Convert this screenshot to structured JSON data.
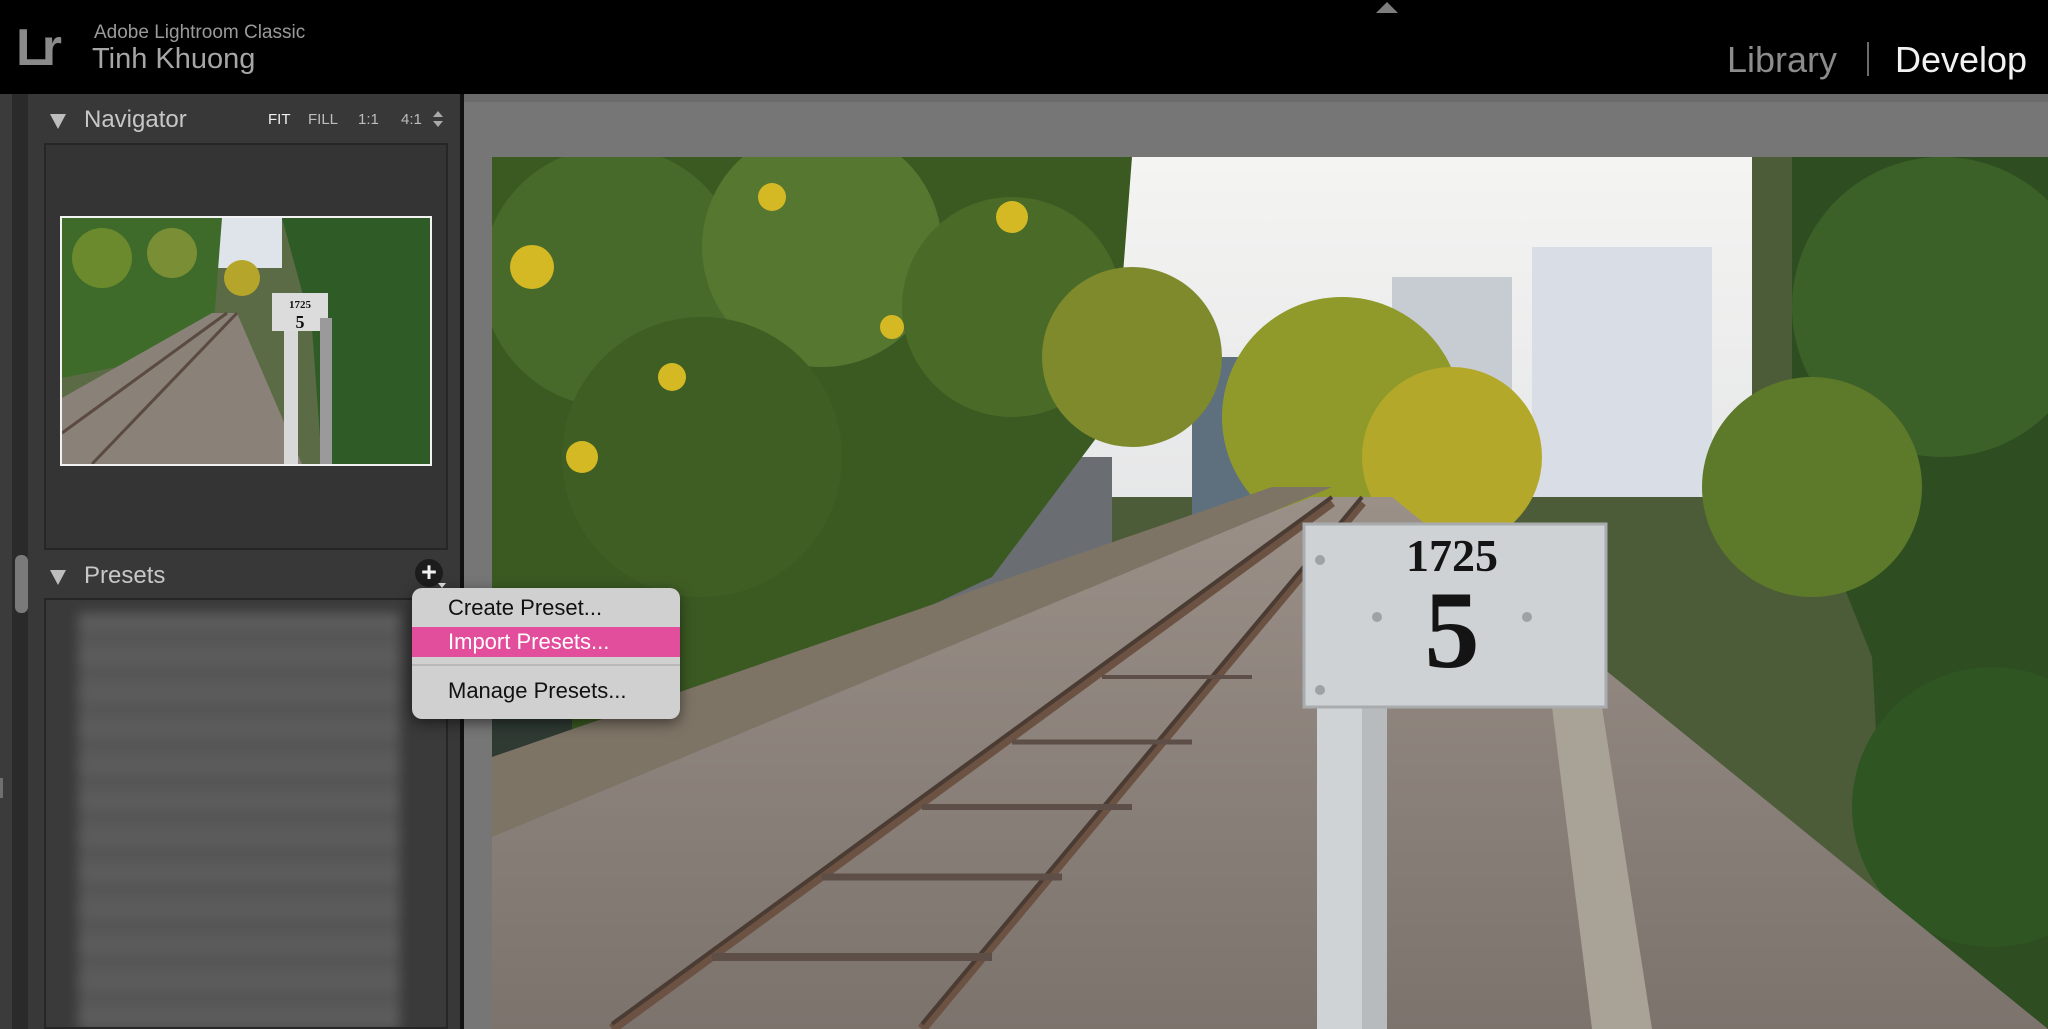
{
  "topbar": {
    "logo": "Lr",
    "app_name": "Adobe Lightroom Classic",
    "user_name": "Tinh Khuong",
    "modules": {
      "library": "Library",
      "develop": "Develop",
      "active": "Develop"
    }
  },
  "navigator": {
    "title": "Navigator",
    "zoom_options": [
      "FIT",
      "FILL",
      "1:1",
      "4:1"
    ],
    "selected_zoom": "FIT"
  },
  "presets": {
    "title": "Presets"
  },
  "preset_menu": {
    "items": [
      "Create Preset...",
      "Import Presets...",
      "Manage Presets..."
    ],
    "highlighted": "Import Presets...",
    "highlight_color": "#e24e9b"
  },
  "photo": {
    "sign_number": "1725",
    "sign_digit": "5"
  },
  "icons": [
    "collapse-arrow-icon",
    "disclosure-triangle-icon",
    "zoom-stepper-icon",
    "add-preset-icon"
  ]
}
